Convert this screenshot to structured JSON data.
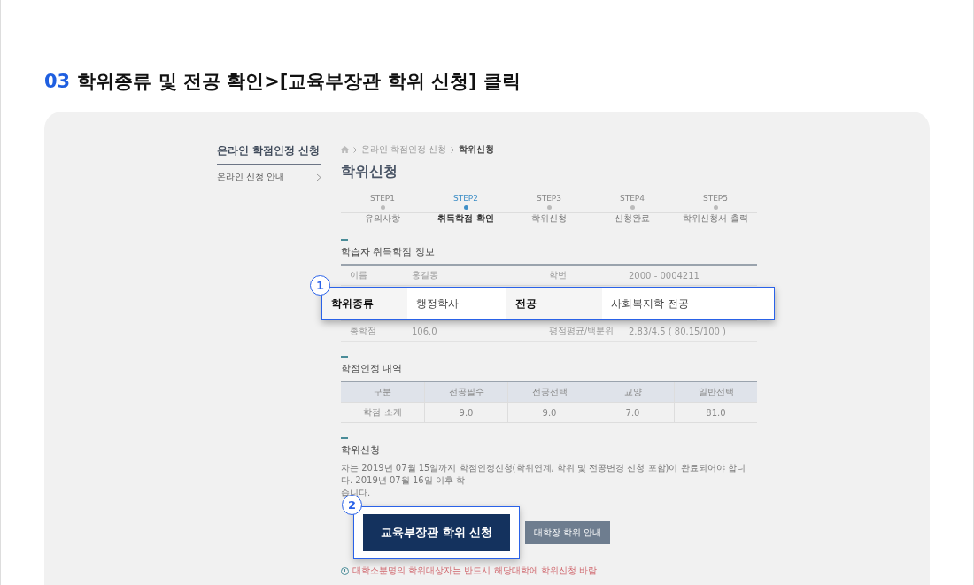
{
  "heading": {
    "number": "03",
    "text": "학위종류 및 전공 확인>[교육부장관 학위 신청] 클릭"
  },
  "sidebar": {
    "title": "온라인 학점인정 신청",
    "items": [
      {
        "label": "온라인 신청 안내"
      }
    ]
  },
  "breadcrumb": [
    "온라인 학점인정 신청",
    "학위신청"
  ],
  "page_title": "학위신청",
  "steps": [
    {
      "step": "STEP1",
      "label": "유의사항",
      "selected": false
    },
    {
      "step": "STEP2",
      "label": "취득학점 확인",
      "selected": true
    },
    {
      "step": "STEP3",
      "label": "학위신청",
      "selected": false
    },
    {
      "step": "STEP4",
      "label": "신청완료",
      "selected": false
    },
    {
      "step": "STEP5",
      "label": "학위신청서 출력",
      "selected": false
    }
  ],
  "info_section": {
    "title": "학습자 취득학점 정보",
    "rows": [
      {
        "label_1": "이름",
        "value_1": "홍길동",
        "label_2": "학번",
        "value_2": "2000 - 0004211"
      },
      {
        "label_1": "총학점",
        "value_1": "106.0",
        "label_2": "평점평균/백분위",
        "value_2": "2.83/4.5 ( 80.15/100 )"
      }
    ]
  },
  "callout_1": {
    "badge": "1",
    "cells": [
      "학위종류",
      "행정학사",
      "전공",
      "사회복지학 전공"
    ]
  },
  "credit_section": {
    "title": "학점인정 내역",
    "columns": [
      "구분",
      "전공필수",
      "전공선택",
      "교양",
      "일반선택"
    ],
    "rows": [
      [
        "학점 소계",
        "9.0",
        "9.0",
        "7.0",
        "81.0"
      ]
    ]
  },
  "apply_section": {
    "title": "학위신청",
    "notice_lines": [
      "자는 2019년 07월 15일까지 학점인정신청(학위연계, 학위 및 전공변경 신청 포함)이 완료되어야 합니다. 2019년 07월 16일 이후 학",
      "습니다."
    ],
    "button": "대학장 학위 안내",
    "warning": "대학소분명의 학위대상자는 반드시 해당대학에 학위신청 바람"
  },
  "callout_2": {
    "badge": "2",
    "button": "교육부장관 학위 신청"
  }
}
